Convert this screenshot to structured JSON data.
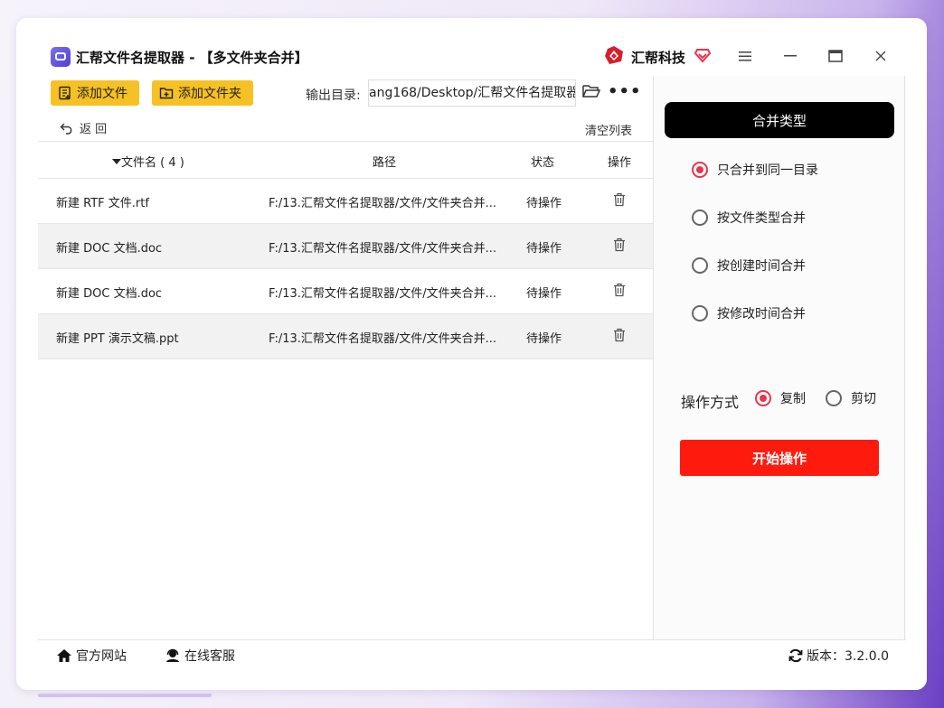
{
  "app": {
    "title": "汇帮文件名提取器 - 【多文件夹合并】",
    "brand": "汇帮科技"
  },
  "toolbar": {
    "add_file": "添加文件",
    "add_folder": "添加文件夹",
    "output_label": "输出目录:",
    "output_path": "ang168/Desktop/汇帮文件名提取器",
    "more": "•••",
    "back": "返  回",
    "clear_list": "清空列表"
  },
  "table": {
    "headers": {
      "name": "文件名 ( 4 )",
      "path": "路径",
      "status": "状态",
      "op": "操作"
    },
    "rows": [
      {
        "name": "新建 RTF 文件.rtf",
        "path": "F:/13.汇帮文件名提取器/文件/文件夹合并...",
        "status": "待操作"
      },
      {
        "name": "新建 DOC 文档.doc",
        "path": "F:/13.汇帮文件名提取器/文件/文件夹合并...",
        "status": "待操作"
      },
      {
        "name": "新建 DOC 文档.doc",
        "path": "F:/13.汇帮文件名提取器/文件/文件夹合并...",
        "status": "待操作"
      },
      {
        "name": "新建 PPT 演示文稿.ppt",
        "path": "F:/13.汇帮文件名提取器/文件/文件夹合并...",
        "status": "待操作"
      }
    ]
  },
  "panel": {
    "merge_title": "合并类型",
    "options": [
      {
        "label": "只合并到同一目录",
        "selected": true
      },
      {
        "label": "按文件类型合并",
        "selected": false
      },
      {
        "label": "按创建时间合并",
        "selected": false
      },
      {
        "label": "按修改时间合并",
        "selected": false
      }
    ],
    "op_label": "操作方式",
    "op_copy": "复制",
    "op_cut": "剪切",
    "op_selected": "复制",
    "start": "开始操作"
  },
  "footer": {
    "site": "官方网站",
    "service": "在线客服",
    "version": "版本：3.2.0.0"
  },
  "colors": {
    "accent_yellow": "#f6c124",
    "accent_red": "#ff1a0e",
    "radio_red": "#e8344e"
  }
}
